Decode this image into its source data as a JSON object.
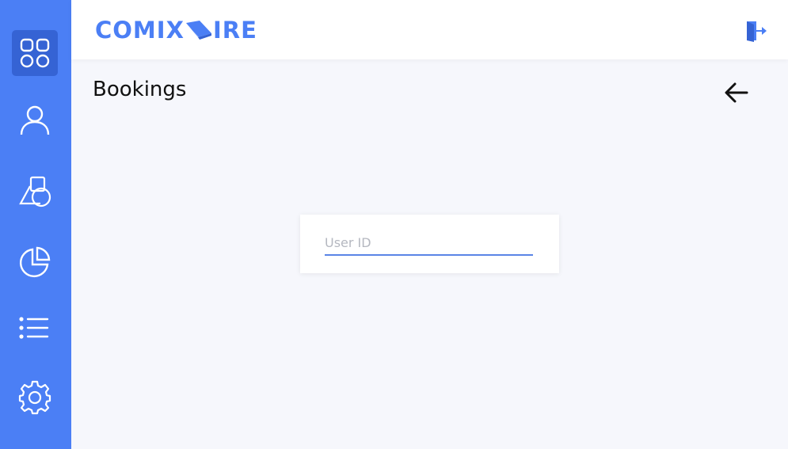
{
  "app": {
    "logo_text_left": "COMIX",
    "logo_text_right": "IRE"
  },
  "sidebar": {
    "items": [
      {
        "name": "dashboard",
        "icon": "grid-icon",
        "active": true
      },
      {
        "name": "users",
        "icon": "user-icon",
        "active": false
      },
      {
        "name": "shapes",
        "icon": "shapes-icon",
        "active": false
      },
      {
        "name": "reports",
        "icon": "pie-chart-icon",
        "active": false
      },
      {
        "name": "list",
        "icon": "list-icon",
        "active": false
      },
      {
        "name": "settings",
        "icon": "gear-icon",
        "active": false
      }
    ]
  },
  "header": {
    "logout_icon": "logout-icon"
  },
  "page": {
    "title": "Bookings",
    "back_icon": "arrow-left-icon"
  },
  "form": {
    "user_id": {
      "placeholder": "User ID",
      "value": ""
    }
  },
  "colors": {
    "primary": "#4b7ff5",
    "active_nav": "#3563d4",
    "background": "#f6f7fc"
  }
}
